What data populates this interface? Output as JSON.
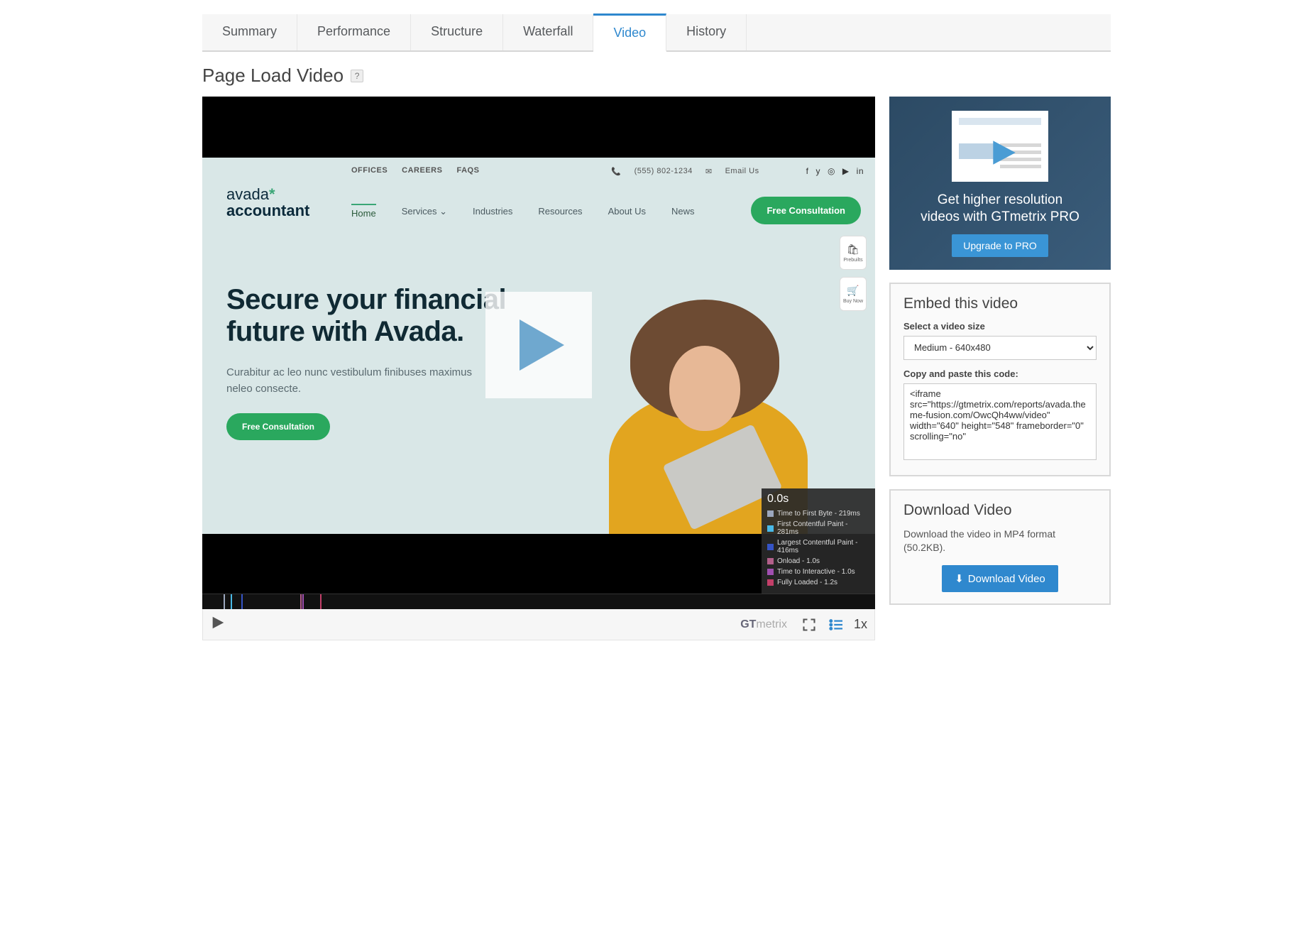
{
  "tabs": [
    {
      "label": "Summary"
    },
    {
      "label": "Performance"
    },
    {
      "label": "Structure"
    },
    {
      "label": "Waterfall"
    },
    {
      "label": "Video",
      "active": true
    },
    {
      "label": "History"
    }
  ],
  "page_title": "Page Load Video",
  "help_symbol": "?",
  "site_mock": {
    "toplinks": [
      "OFFICES",
      "CAREERS",
      "FAQS"
    ],
    "phone_icon": "📞",
    "phone": "(555) 802-1234",
    "email_icon": "✉",
    "email_label": "Email Us",
    "social": [
      "f",
      "y",
      "◎",
      "▶",
      "in"
    ],
    "logo_line1": "avada",
    "logo_star": "*",
    "logo_line2": "accountant",
    "nav": [
      "Home",
      "Services ⌄",
      "Industries",
      "Resources",
      "About Us",
      "News"
    ],
    "cta": "Free Consultation",
    "badges": [
      {
        "icon": "🛍",
        "label": "Prebuilts"
      },
      {
        "icon": "🛒",
        "label": "Buy Now"
      }
    ],
    "hero_h1a": "Secure your financial",
    "hero_h1b": "future with Avada.",
    "hero_sub": "Curabitur ac leo nunc vestibulum finibuses maximus neleo consecte.",
    "hero_cta": "Free Consultation"
  },
  "metrics": {
    "time": "0.0s",
    "items": [
      {
        "color": "#9ca7bd",
        "label": "Time to First Byte - 219ms"
      },
      {
        "color": "#49b9e6",
        "label": "First Contentful Paint - 281ms"
      },
      {
        "color": "#3554c6",
        "label": "Largest Contentful Paint - 416ms"
      },
      {
        "color": "#b25f8a",
        "label": "Onload - 1.0s"
      },
      {
        "color": "#a04fb0",
        "label": "Time to Interactive - 1.0s"
      },
      {
        "color": "#c33f69",
        "label": "Fully Loaded - 1.2s"
      }
    ]
  },
  "filmstrip_markers": [
    {
      "pos": 3.2,
      "color": "#9ca7bd"
    },
    {
      "pos": 4.2,
      "color": "#49b9e6"
    },
    {
      "pos": 5.8,
      "color": "#3554c6"
    },
    {
      "pos": 14.6,
      "color": "#b25f8a"
    },
    {
      "pos": 14.9,
      "color": "#a04fb0"
    },
    {
      "pos": 17.5,
      "color": "#c33f69"
    }
  ],
  "player": {
    "brand1": "GT",
    "brand2": "metrix",
    "speed": "1x"
  },
  "promo": {
    "line1": "Get higher resolution",
    "line2": "videos with GTmetrix PRO",
    "button": "Upgrade to PRO"
  },
  "embed": {
    "heading": "Embed this video",
    "size_label": "Select a video size",
    "size_value": "Medium - 640x480",
    "code_label": "Copy and paste this code:",
    "code": "<iframe src=\"https://gtmetrix.com/reports/avada.theme-fusion.com/OwcQh4ww/video\" width=\"640\" height=\"548\" frameborder=\"0\" scrolling=\"no\""
  },
  "download": {
    "heading": "Download Video",
    "text": "Download the video in MP4 format (50.2KB).",
    "button": "Download Video"
  }
}
